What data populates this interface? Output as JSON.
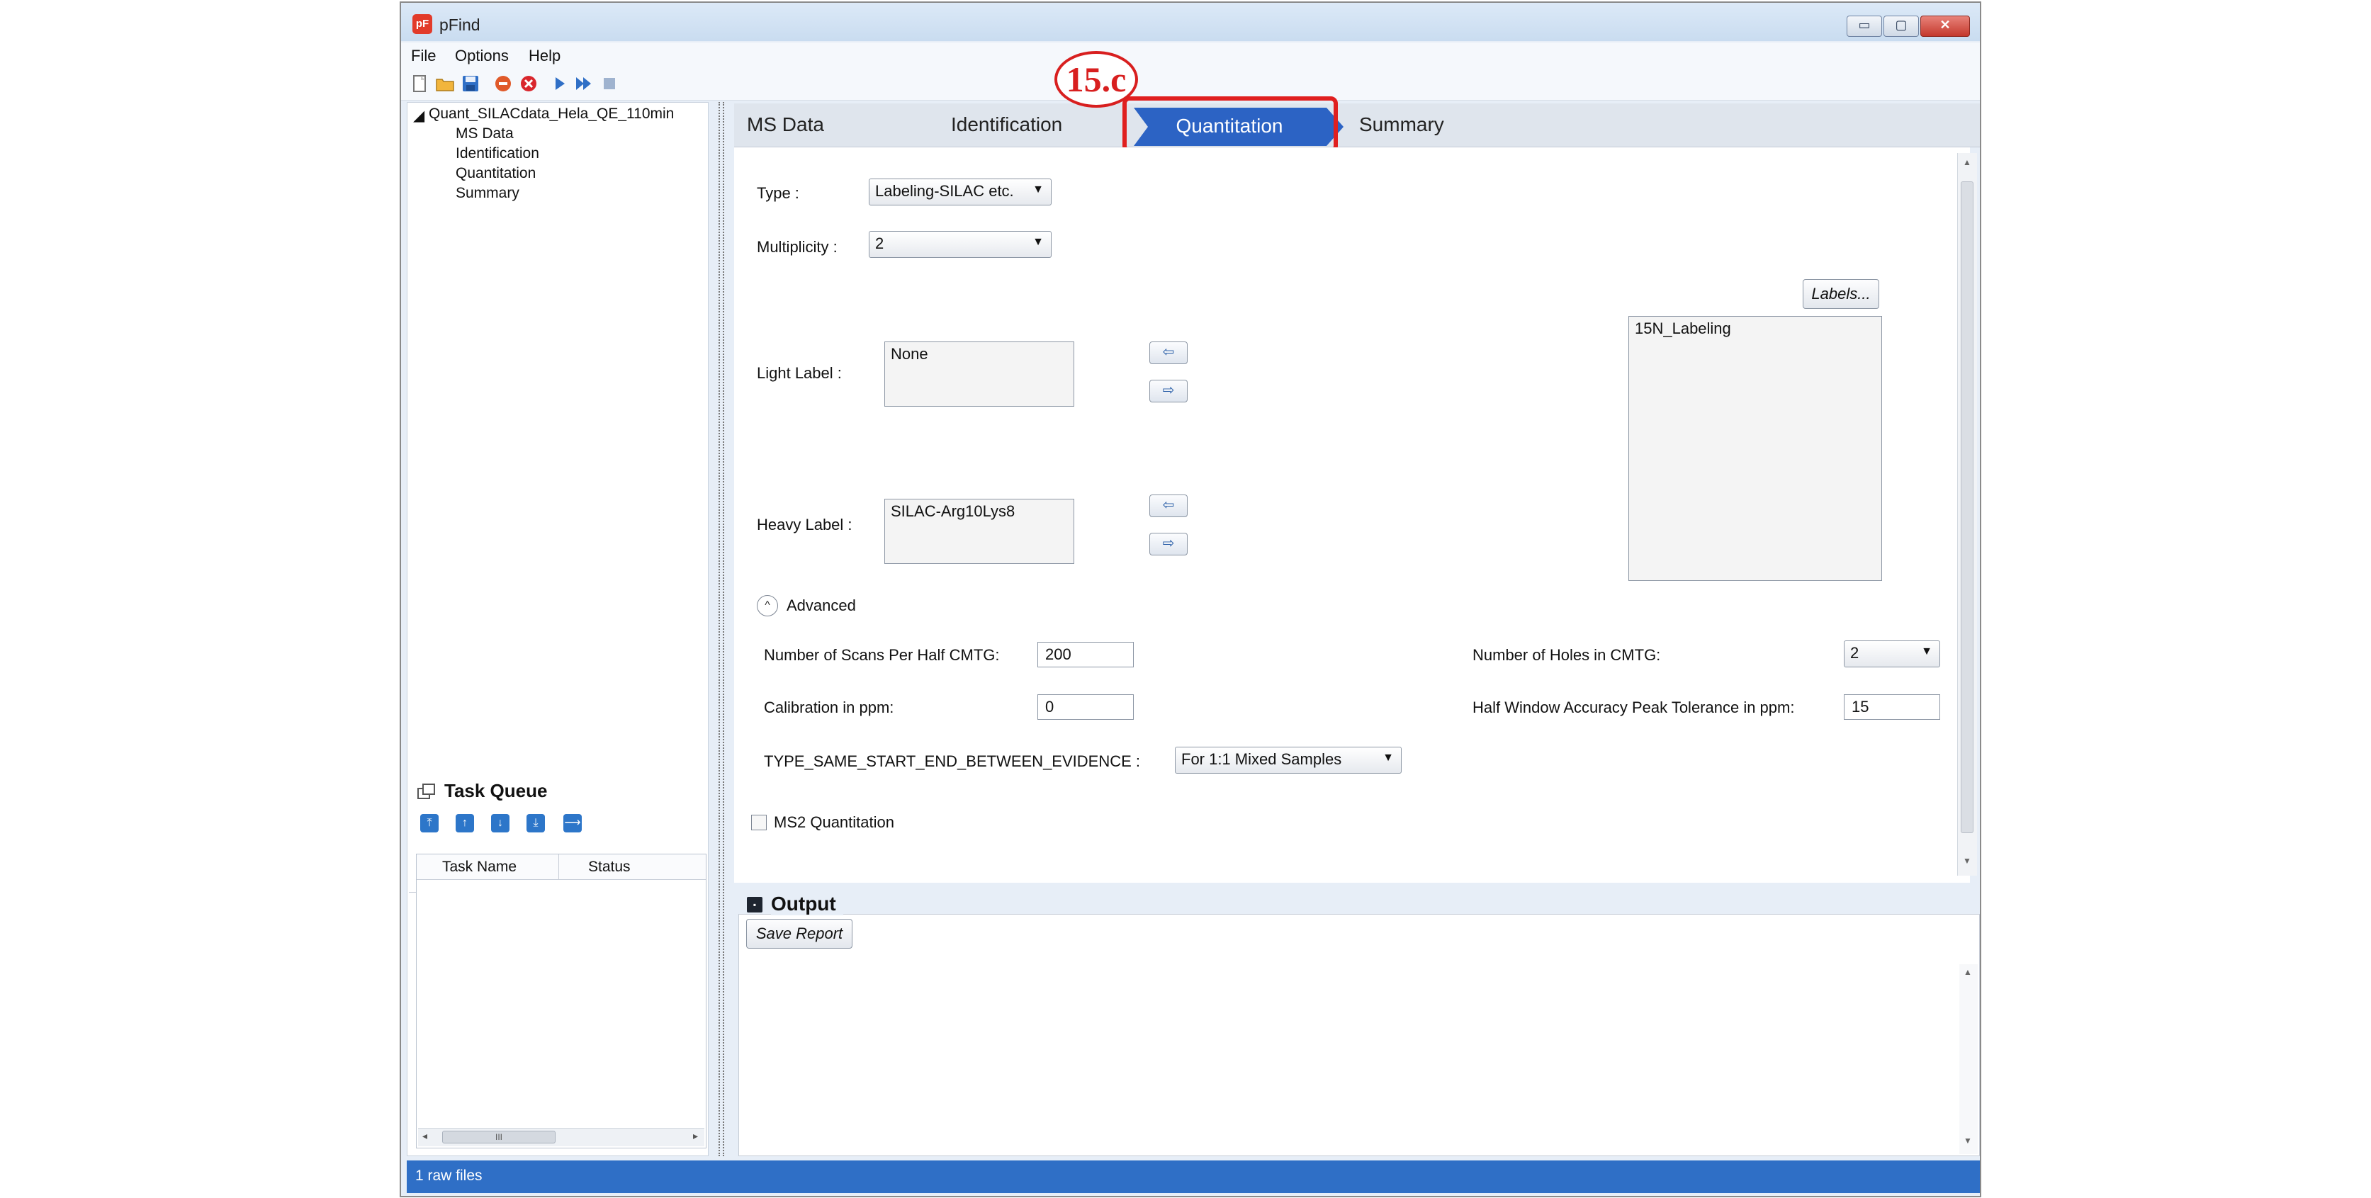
{
  "window": {
    "title": "pFind",
    "icon": "pF",
    "controls": {
      "minimize": "▭",
      "maximize": "▢",
      "close": "✕"
    }
  },
  "menu": [
    {
      "label": "File"
    },
    {
      "label": "Options"
    },
    {
      "label": "Help"
    }
  ],
  "toolbar_icons": [
    "new-file-icon",
    "open-folder-icon",
    "save-icon",
    "stop-icon",
    "delete-icon",
    "run-icon",
    "run-all-icon",
    "stop-square-icon"
  ],
  "tree": {
    "root": "Quant_SILACdata_Hela_QE_110min",
    "items": [
      "MS Data",
      "Identification",
      "Quantitation",
      "Summary"
    ]
  },
  "task_queue": {
    "title": "Task Queue",
    "columns": [
      "Task Name",
      "Status"
    ],
    "scroll_grip": "III"
  },
  "tabs": {
    "items": [
      "MS Data",
      "Identification",
      "Quantitation",
      "Summary"
    ],
    "active": "Quantitation"
  },
  "annotation": {
    "step_label": "15.c",
    "color": "#e01f1f"
  },
  "form": {
    "type_label": "Type :",
    "type_value": "Labeling-SILAC etc.",
    "multiplicity_label": "Multiplicity :",
    "multiplicity_value": "2",
    "labels_button": "Labels...",
    "light_label": "Light Label :",
    "light_value": "None",
    "heavy_label": "Heavy Label :",
    "heavy_value": "SILAC-Arg10Lys8",
    "available_labels": [
      "15N_Labeling"
    ],
    "advanced_label": "Advanced",
    "scans_label": "Number of Scans Per Half CMTG:",
    "scans_value": "200",
    "calibration_label": "Calibration in ppm:",
    "calibration_value": "0",
    "holes_label": "Number of Holes in CMTG:",
    "holes_value": "2",
    "half_window_label": "Half Window Accuracy Peak Tolerance in ppm:",
    "half_window_value": "15",
    "type_same_label": "TYPE_SAME_START_END_BETWEEN_EVIDENCE :",
    "type_same_value": "For 1:1 Mixed Samples",
    "ms2_label": "MS2 Quantitation",
    "ms2_checked": false
  },
  "output": {
    "title": "Output",
    "save_button": "Save Report"
  },
  "status": {
    "text": "1 raw files"
  },
  "colors": {
    "active_tab": "#2c63c4",
    "status_bar": "#2f6fc6"
  }
}
